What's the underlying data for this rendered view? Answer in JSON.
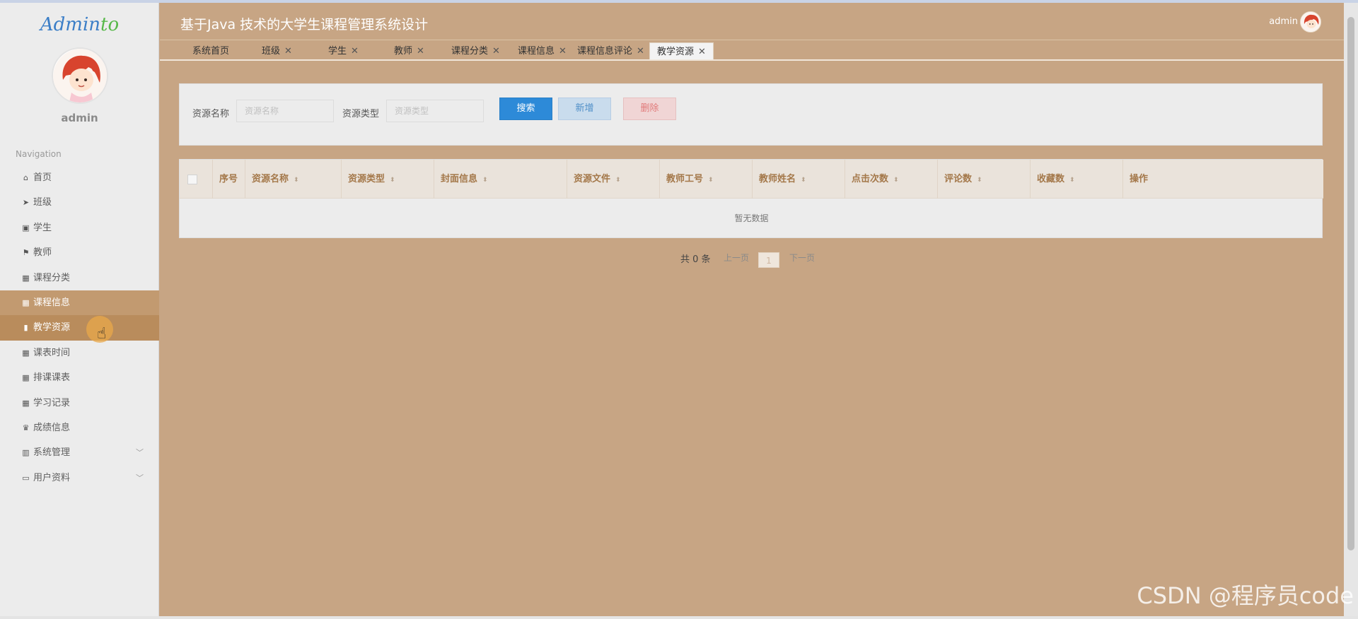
{
  "brand": {
    "logo_main": "Admin",
    "logo_accent": "to"
  },
  "sidebar": {
    "username": "admin",
    "nav_title": "Navigation",
    "items": [
      {
        "icon": "home-icon",
        "glyph": "⌂",
        "label": "首页"
      },
      {
        "icon": "paper-plane-icon",
        "glyph": "➤",
        "label": "班级"
      },
      {
        "icon": "clipboard-icon",
        "glyph": "▣",
        "label": "学生"
      },
      {
        "icon": "flag-icon",
        "glyph": "⚑",
        "label": "教师"
      },
      {
        "icon": "grid-icon",
        "glyph": "▦",
        "label": "课程分类"
      },
      {
        "icon": "grid-icon",
        "glyph": "▦",
        "label": "课程信息"
      },
      {
        "icon": "bar-chart-icon",
        "glyph": "▮",
        "label": "教学资源"
      },
      {
        "icon": "grid-icon",
        "glyph": "▦",
        "label": "课表时间"
      },
      {
        "icon": "grid-icon",
        "glyph": "▦",
        "label": "排课课表"
      },
      {
        "icon": "grid-icon",
        "glyph": "▦",
        "label": "学习记录"
      },
      {
        "icon": "trophy-icon",
        "glyph": "♛",
        "label": "成绩信息"
      },
      {
        "icon": "library-icon",
        "glyph": "▥",
        "label": "系统管理"
      },
      {
        "icon": "id-card-icon",
        "glyph": "▭",
        "label": "用户资料"
      }
    ]
  },
  "header": {
    "title": "基于Java 技术的大学生课程管理系统设计",
    "user": "admin"
  },
  "tabs": [
    {
      "label": "系统首页",
      "closable": false
    },
    {
      "label": "班级",
      "closable": true
    },
    {
      "label": "学生",
      "closable": true
    },
    {
      "label": "教师",
      "closable": true
    },
    {
      "label": "课程分类",
      "closable": true
    },
    {
      "label": "课程信息",
      "closable": true
    },
    {
      "label": "课程信息评论",
      "closable": true
    },
    {
      "label": "教学资源",
      "closable": true
    }
  ],
  "close_glyph": "✕",
  "search": {
    "name_label": "资源名称",
    "name_placeholder": "资源名称",
    "type_label": "资源类型",
    "type_placeholder": "资源类型",
    "search_button": "搜索",
    "add_button": "新增",
    "delete_button": "删除"
  },
  "table": {
    "columns": [
      "序号",
      "资源名称",
      "资源类型",
      "封面信息",
      "资源文件",
      "教师工号",
      "教师姓名",
      "点击次数",
      "评论数",
      "收藏数",
      "操作"
    ],
    "empty_text": "暂无数据"
  },
  "pagination": {
    "total": "共 0 条",
    "prev": "上一页",
    "page": "1",
    "next": "下一页"
  },
  "watermark": "CSDN @程序员code",
  "colors": {
    "main_bg": "#c7a584",
    "sidebar_bg": "#ececec",
    "active_item": "#b98c5c",
    "primary": "#2d8ad8",
    "danger_text": "#e17a7a"
  }
}
